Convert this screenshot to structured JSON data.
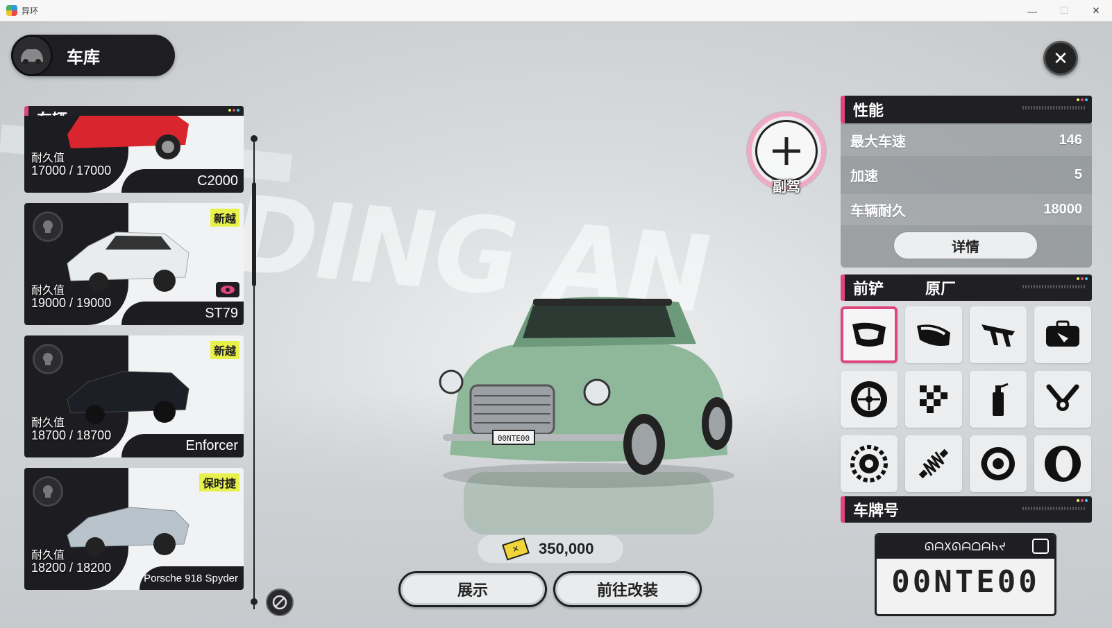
{
  "window": {
    "title": "异环"
  },
  "header": {
    "title": "车库"
  },
  "vehicles_panel": {
    "title": "车辆"
  },
  "vehicles": [
    {
      "name": "C2000",
      "durability_label": "耐久值",
      "durability": "17000 / 17000",
      "brand": "",
      "color": "#d8252e"
    },
    {
      "name": "ST79",
      "durability_label": "耐久值",
      "durability": "19000 / 19000",
      "brand": "新越",
      "color": "#e9ecef"
    },
    {
      "name": "Enforcer",
      "durability_label": "耐久值",
      "durability": "18700 / 18700",
      "brand": "新越",
      "color": "#1c2026"
    },
    {
      "name": "Porsche 918 Spyder",
      "durability_label": "耐久值",
      "durability": "18200 / 18200",
      "brand": "保时捷",
      "color": "#b9c3cc"
    }
  ],
  "copilot": {
    "label": "副驾"
  },
  "performance": {
    "title": "性能",
    "rows": [
      {
        "label": "最大车速",
        "value": "146"
      },
      {
        "label": "加速",
        "value": "5"
      },
      {
        "label": "车辆耐久",
        "value": "18000"
      }
    ],
    "detail_button": "详情"
  },
  "parts": {
    "category": "前铲",
    "selection": "原厂",
    "icons": [
      "front-bumper-icon",
      "rear-bumper-icon",
      "spoiler-icon",
      "trunk-icon",
      "rim-icon",
      "paint-icon",
      "spray-icon",
      "engine-icon",
      "gear-icon",
      "suspension-icon",
      "brake-icon",
      "tire-icon"
    ]
  },
  "plate_section": {
    "title": "车牌号",
    "header_text": "ᘏᗩXᘏᗩᗝᗩᏂᔪ",
    "number": "00NTE00",
    "car_plate": "00NTE00"
  },
  "price": {
    "value": "350,000"
  },
  "actions": {
    "showcase": "展示",
    "modify": "前往改装"
  },
  "background": {
    "text": "DING AN"
  },
  "colors": {
    "accent": "#e0457b",
    "dark": "#1f1f23",
    "car": "#8fb89a",
    "brand_tag": "#e8f14a"
  }
}
